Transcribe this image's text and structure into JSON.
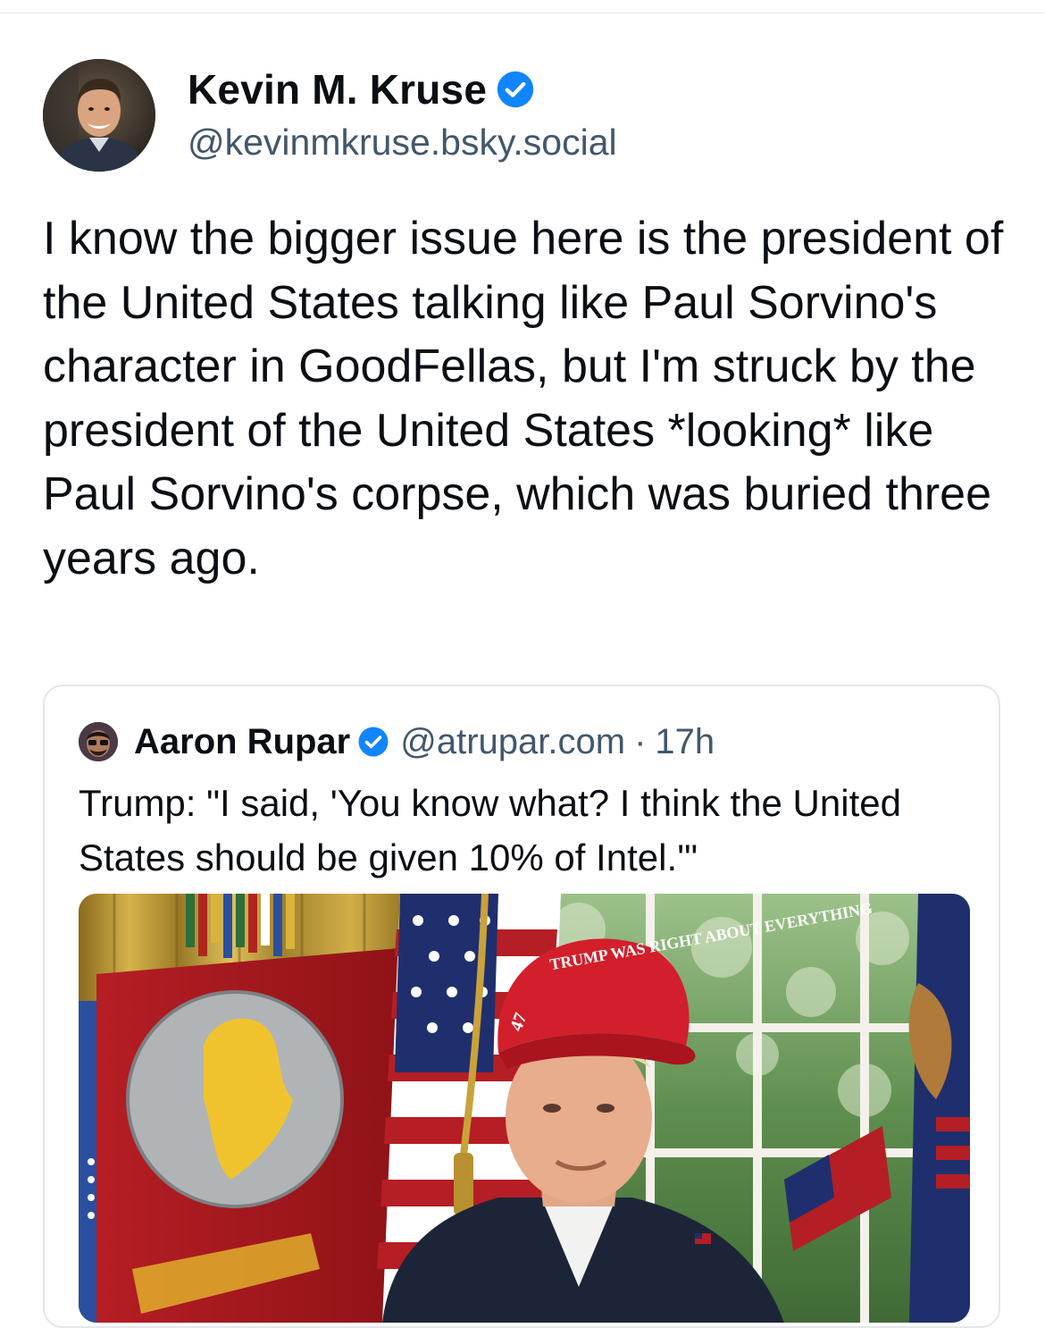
{
  "post": {
    "author_name": "Kevin M. Kruse",
    "author_handle": "@kevinmkruse.bsky.social",
    "text": "I know the bigger issue here is the president of the United States talking like Paul Sorvino's character in GoodFellas, but I'm struck by the president of the United States *looking* like Paul Sorvino's corpse, which was buried three years ago."
  },
  "quote": {
    "author_name": "Aaron Rupar",
    "author_handle": "@atrupar.com",
    "separator": "·",
    "time": "17h",
    "text": "Trump: \"I said, 'You know what? I think the United States should be given 10% of Intel.'\"",
    "media": {
      "hat_text": "TRUMP WAS RIGHT ABOUT EVERYTHING",
      "hat_side_text": "47"
    }
  },
  "colors": {
    "verified_blue": "#1185fe",
    "handle_gray": "#42576c",
    "border": "#e3e6ea",
    "text": "#0b0f14"
  },
  "icons": {
    "verified": "verified-check-icon"
  }
}
